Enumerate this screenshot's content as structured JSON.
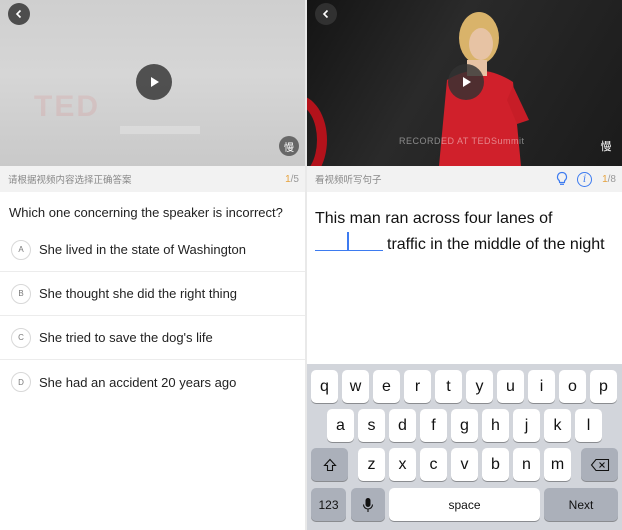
{
  "left": {
    "hint": "请根据视频内容选择正确答案",
    "progress": {
      "current": "1",
      "total": "/5"
    },
    "slow_label": "慢",
    "question": "Which one concerning the speaker is incorrect?",
    "options": [
      {
        "letter": "A",
        "text": "She lived in the state of Washington"
      },
      {
        "letter": "B",
        "text": "She thought she did the right thing"
      },
      {
        "letter": "C",
        "text": "She tried to save the dog's life"
      },
      {
        "letter": "D",
        "text": "She had an accident 20 years ago"
      }
    ]
  },
  "right": {
    "hint": "看视频听写句子",
    "progress": {
      "current": "1",
      "total": "/8"
    },
    "slow_label": "慢",
    "video_caption": "RECORDED AT TEDSummit",
    "sentence": {
      "before": "This man ran across four lanes of",
      "after": "traffic in the middle of the night"
    },
    "keyboard": {
      "row1": [
        "q",
        "w",
        "e",
        "r",
        "t",
        "y",
        "u",
        "i",
        "o",
        "p"
      ],
      "row2": [
        "a",
        "s",
        "d",
        "f",
        "g",
        "h",
        "j",
        "k",
        "l"
      ],
      "row3": [
        "z",
        "x",
        "c",
        "v",
        "b",
        "n",
        "m"
      ],
      "numbers_label": "123",
      "space_label": "space",
      "next_label": "Next"
    }
  },
  "icons": {
    "back": "chevron-left-icon",
    "play": "play-icon",
    "hint": "lightbulb-icon",
    "info": "info-icon",
    "shift": "shift-icon",
    "delete": "backspace-icon",
    "mic": "microphone-icon"
  },
  "colors": {
    "accent": "#3d7bf0",
    "progress": "#e6a23c",
    "dress": "#d0202b"
  }
}
